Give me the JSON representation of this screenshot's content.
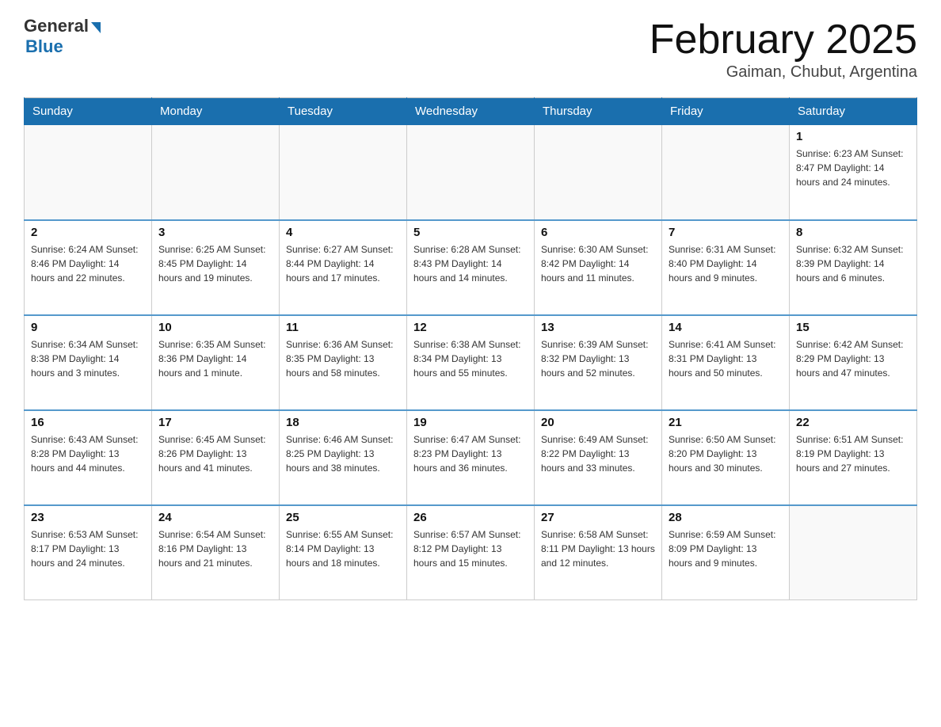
{
  "header": {
    "logo_general": "General",
    "logo_blue": "Blue",
    "month_title": "February 2025",
    "location": "Gaiman, Chubut, Argentina"
  },
  "days_of_week": [
    "Sunday",
    "Monday",
    "Tuesday",
    "Wednesday",
    "Thursday",
    "Friday",
    "Saturday"
  ],
  "weeks": [
    [
      {
        "day": "",
        "info": ""
      },
      {
        "day": "",
        "info": ""
      },
      {
        "day": "",
        "info": ""
      },
      {
        "day": "",
        "info": ""
      },
      {
        "day": "",
        "info": ""
      },
      {
        "day": "",
        "info": ""
      },
      {
        "day": "1",
        "info": "Sunrise: 6:23 AM\nSunset: 8:47 PM\nDaylight: 14 hours and 24 minutes."
      }
    ],
    [
      {
        "day": "2",
        "info": "Sunrise: 6:24 AM\nSunset: 8:46 PM\nDaylight: 14 hours and 22 minutes."
      },
      {
        "day": "3",
        "info": "Sunrise: 6:25 AM\nSunset: 8:45 PM\nDaylight: 14 hours and 19 minutes."
      },
      {
        "day": "4",
        "info": "Sunrise: 6:27 AM\nSunset: 8:44 PM\nDaylight: 14 hours and 17 minutes."
      },
      {
        "day": "5",
        "info": "Sunrise: 6:28 AM\nSunset: 8:43 PM\nDaylight: 14 hours and 14 minutes."
      },
      {
        "day": "6",
        "info": "Sunrise: 6:30 AM\nSunset: 8:42 PM\nDaylight: 14 hours and 11 minutes."
      },
      {
        "day": "7",
        "info": "Sunrise: 6:31 AM\nSunset: 8:40 PM\nDaylight: 14 hours and 9 minutes."
      },
      {
        "day": "8",
        "info": "Sunrise: 6:32 AM\nSunset: 8:39 PM\nDaylight: 14 hours and 6 minutes."
      }
    ],
    [
      {
        "day": "9",
        "info": "Sunrise: 6:34 AM\nSunset: 8:38 PM\nDaylight: 14 hours and 3 minutes."
      },
      {
        "day": "10",
        "info": "Sunrise: 6:35 AM\nSunset: 8:36 PM\nDaylight: 14 hours and 1 minute."
      },
      {
        "day": "11",
        "info": "Sunrise: 6:36 AM\nSunset: 8:35 PM\nDaylight: 13 hours and 58 minutes."
      },
      {
        "day": "12",
        "info": "Sunrise: 6:38 AM\nSunset: 8:34 PM\nDaylight: 13 hours and 55 minutes."
      },
      {
        "day": "13",
        "info": "Sunrise: 6:39 AM\nSunset: 8:32 PM\nDaylight: 13 hours and 52 minutes."
      },
      {
        "day": "14",
        "info": "Sunrise: 6:41 AM\nSunset: 8:31 PM\nDaylight: 13 hours and 50 minutes."
      },
      {
        "day": "15",
        "info": "Sunrise: 6:42 AM\nSunset: 8:29 PM\nDaylight: 13 hours and 47 minutes."
      }
    ],
    [
      {
        "day": "16",
        "info": "Sunrise: 6:43 AM\nSunset: 8:28 PM\nDaylight: 13 hours and 44 minutes."
      },
      {
        "day": "17",
        "info": "Sunrise: 6:45 AM\nSunset: 8:26 PM\nDaylight: 13 hours and 41 minutes."
      },
      {
        "day": "18",
        "info": "Sunrise: 6:46 AM\nSunset: 8:25 PM\nDaylight: 13 hours and 38 minutes."
      },
      {
        "day": "19",
        "info": "Sunrise: 6:47 AM\nSunset: 8:23 PM\nDaylight: 13 hours and 36 minutes."
      },
      {
        "day": "20",
        "info": "Sunrise: 6:49 AM\nSunset: 8:22 PM\nDaylight: 13 hours and 33 minutes."
      },
      {
        "day": "21",
        "info": "Sunrise: 6:50 AM\nSunset: 8:20 PM\nDaylight: 13 hours and 30 minutes."
      },
      {
        "day": "22",
        "info": "Sunrise: 6:51 AM\nSunset: 8:19 PM\nDaylight: 13 hours and 27 minutes."
      }
    ],
    [
      {
        "day": "23",
        "info": "Sunrise: 6:53 AM\nSunset: 8:17 PM\nDaylight: 13 hours and 24 minutes."
      },
      {
        "day": "24",
        "info": "Sunrise: 6:54 AM\nSunset: 8:16 PM\nDaylight: 13 hours and 21 minutes."
      },
      {
        "day": "25",
        "info": "Sunrise: 6:55 AM\nSunset: 8:14 PM\nDaylight: 13 hours and 18 minutes."
      },
      {
        "day": "26",
        "info": "Sunrise: 6:57 AM\nSunset: 8:12 PM\nDaylight: 13 hours and 15 minutes."
      },
      {
        "day": "27",
        "info": "Sunrise: 6:58 AM\nSunset: 8:11 PM\nDaylight: 13 hours and 12 minutes."
      },
      {
        "day": "28",
        "info": "Sunrise: 6:59 AM\nSunset: 8:09 PM\nDaylight: 13 hours and 9 minutes."
      },
      {
        "day": "",
        "info": ""
      }
    ]
  ]
}
